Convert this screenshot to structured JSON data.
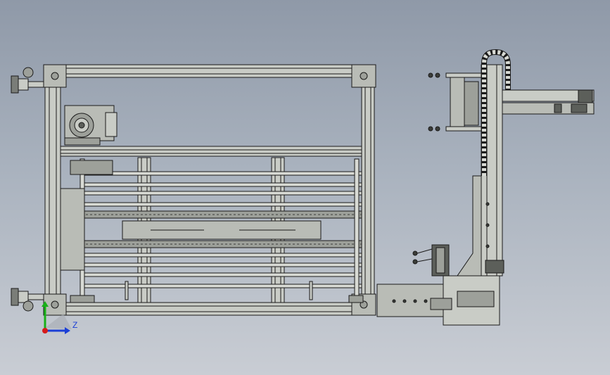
{
  "viewport": {
    "background_top": "#8f99a8",
    "background_bottom": "#c9cdd4"
  },
  "model": {
    "frame_color": "#c9ccc6",
    "edge_color": "#1a1a1a",
    "shade_color": "#9da09a",
    "dark_part_color": "#5c5f5a"
  },
  "triad": {
    "z_label": "Z",
    "x_axis_color": "#d61b1b",
    "y_axis_color": "#19b019",
    "z_axis_color": "#1b3fd6"
  }
}
